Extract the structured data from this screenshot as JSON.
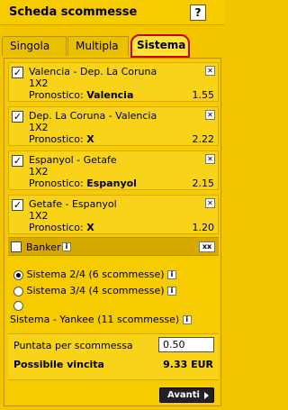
{
  "header": {
    "title": "Scheda scommesse",
    "help": "?"
  },
  "tabs": [
    {
      "label": "Singola",
      "active": false
    },
    {
      "label": "Multipla",
      "active": false
    },
    {
      "label": "Sistema",
      "active": true
    }
  ],
  "bets": [
    {
      "match": "Valencia - Dep. La Coruna",
      "market": "1X2",
      "pronostico_label": "Pronostico:",
      "pick": "Valencia",
      "odds": "1.55",
      "checked": true
    },
    {
      "match": "Dep. La Coruna - Valencia",
      "market": "1X2",
      "pronostico_label": "Pronostico:",
      "pick": "X",
      "odds": "2.22",
      "checked": true
    },
    {
      "match": "Espanyol - Getafe",
      "market": "1X2",
      "pronostico_label": "Pronostico:",
      "pick": "Espanyol",
      "odds": "2.15",
      "checked": true
    },
    {
      "match": "Getafe - Espanyol",
      "market": "1X2",
      "pronostico_label": "Pronostico:",
      "pick": "X",
      "odds": "1.20",
      "checked": true
    }
  ],
  "banker": {
    "label": "Banker",
    "info": "i",
    "remove_all": "xx"
  },
  "systems": [
    {
      "label": "Sistema 2/4 (6 scommesse)",
      "selected": true
    },
    {
      "label": "Sistema 3/4 (4 scommesse)",
      "selected": false
    },
    {
      "label": "Sistema - Yankee (11 scommesse)",
      "selected": false
    }
  ],
  "stake": {
    "label": "Puntata per scommessa",
    "value": "0.50",
    "win_label": "Possibile vincita",
    "win_value": "9.33 EUR"
  },
  "next_button": "Avanti",
  "colors": {
    "background": "#f2c500",
    "active_tab_border": "#d00000"
  }
}
